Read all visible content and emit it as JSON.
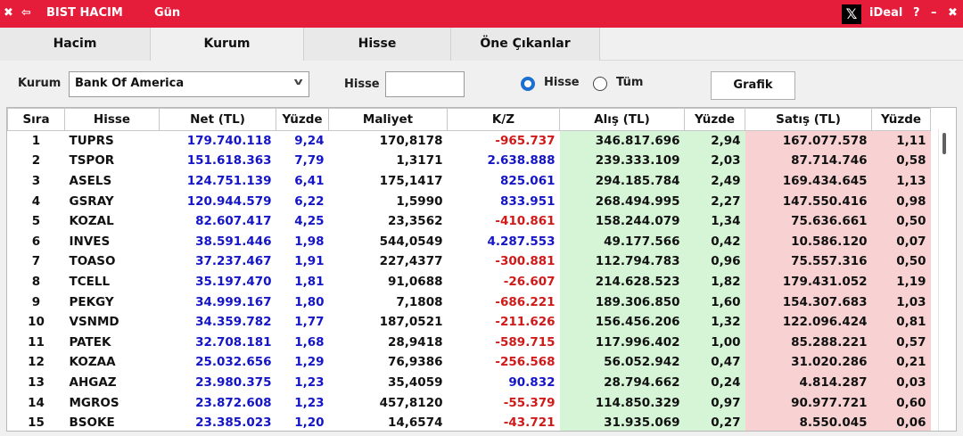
{
  "titlebar": {
    "close_glyph": "✖",
    "back_glyph": "⇦",
    "title": "BIST HACIM",
    "period": "Gün",
    "x_logo": "𝕏",
    "brand": "iDeal",
    "help": "?",
    "minimize": "–",
    "close": "✖"
  },
  "tabs": [
    {
      "label": "Hacim"
    },
    {
      "label": "Kurum"
    },
    {
      "label": "Hisse"
    },
    {
      "label": "Öne Çıkanlar"
    }
  ],
  "filters": {
    "kurum_label": "Kurum",
    "kurum_value": "Bank Of America",
    "hisse_label": "Hisse",
    "hisse_value": "",
    "radio_hisse": "Hisse",
    "radio_tum": "Tüm",
    "grafik_button": "Grafik"
  },
  "table": {
    "columns": [
      "Sıra",
      "Hisse",
      "Net (TL)",
      "Yüzde",
      "Maliyet",
      "K/Z",
      "Alış (TL)",
      "Yüzde",
      "Satış (TL)",
      "Yüzde"
    ],
    "rows": [
      [
        "1",
        "TUPRS",
        "179.740.118",
        "9,24",
        "170,8178",
        "-965.737",
        "346.817.696",
        "2,94",
        "167.077.578",
        "1,11"
      ],
      [
        "2",
        "TSPOR",
        "151.618.363",
        "7,79",
        "1,3171",
        "2.638.888",
        "239.333.109",
        "2,03",
        "87.714.746",
        "0,58"
      ],
      [
        "3",
        "ASELS",
        "124.751.139",
        "6,41",
        "175,1417",
        "825.061",
        "294.185.784",
        "2,49",
        "169.434.645",
        "1,13"
      ],
      [
        "4",
        "GSRAY",
        "120.944.579",
        "6,22",
        "1,5990",
        "833.951",
        "268.494.995",
        "2,27",
        "147.550.416",
        "0,98"
      ],
      [
        "5",
        "KOZAL",
        "82.607.417",
        "4,25",
        "23,3562",
        "-410.861",
        "158.244.079",
        "1,34",
        "75.636.661",
        "0,50"
      ],
      [
        "6",
        "INVES",
        "38.591.446",
        "1,98",
        "544,0549",
        "4.287.553",
        "49.177.566",
        "0,42",
        "10.586.120",
        "0,07"
      ],
      [
        "7",
        "TOASO",
        "37.237.467",
        "1,91",
        "227,4377",
        "-300.881",
        "112.794.783",
        "0,96",
        "75.557.316",
        "0,50"
      ],
      [
        "8",
        "TCELL",
        "35.197.470",
        "1,81",
        "91,0688",
        "-26.607",
        "214.628.523",
        "1,82",
        "179.431.052",
        "1,19"
      ],
      [
        "9",
        "PEKGY",
        "34.999.167",
        "1,80",
        "7,1808",
        "-686.221",
        "189.306.850",
        "1,60",
        "154.307.683",
        "1,03"
      ],
      [
        "10",
        "VSNMD",
        "34.359.782",
        "1,77",
        "187,0521",
        "-211.626",
        "156.456.206",
        "1,32",
        "122.096.424",
        "0,81"
      ],
      [
        "11",
        "PATEK",
        "32.708.181",
        "1,68",
        "28,9418",
        "-589.715",
        "117.996.402",
        "1,00",
        "85.288.221",
        "0,57"
      ],
      [
        "12",
        "KOZAA",
        "25.032.656",
        "1,29",
        "76,9386",
        "-256.568",
        "56.052.942",
        "0,47",
        "31.020.286",
        "0,21"
      ],
      [
        "13",
        "AHGAZ",
        "23.980.375",
        "1,23",
        "35,4059",
        "90.832",
        "28.794.662",
        "0,24",
        "4.814.287",
        "0,03"
      ],
      [
        "14",
        "MGROS",
        "23.872.608",
        "1,23",
        "457,8120",
        "-55.379",
        "114.850.329",
        "0,97",
        "90.977.721",
        "0,60"
      ],
      [
        "15",
        "BSOKE",
        "23.385.023",
        "1,20",
        "14,6574",
        "-43.721",
        "31.935.069",
        "0,27",
        "8.550.045",
        "0,06"
      ]
    ]
  },
  "colors": {
    "titlebar_bg": "#e51c3a",
    "positive_text": "#1515c8",
    "negative_text": "#d01a1a",
    "buy_bg": "#d6f5d6",
    "sell_bg": "#f8d2d2",
    "radio_accent": "#1a6fd1"
  }
}
